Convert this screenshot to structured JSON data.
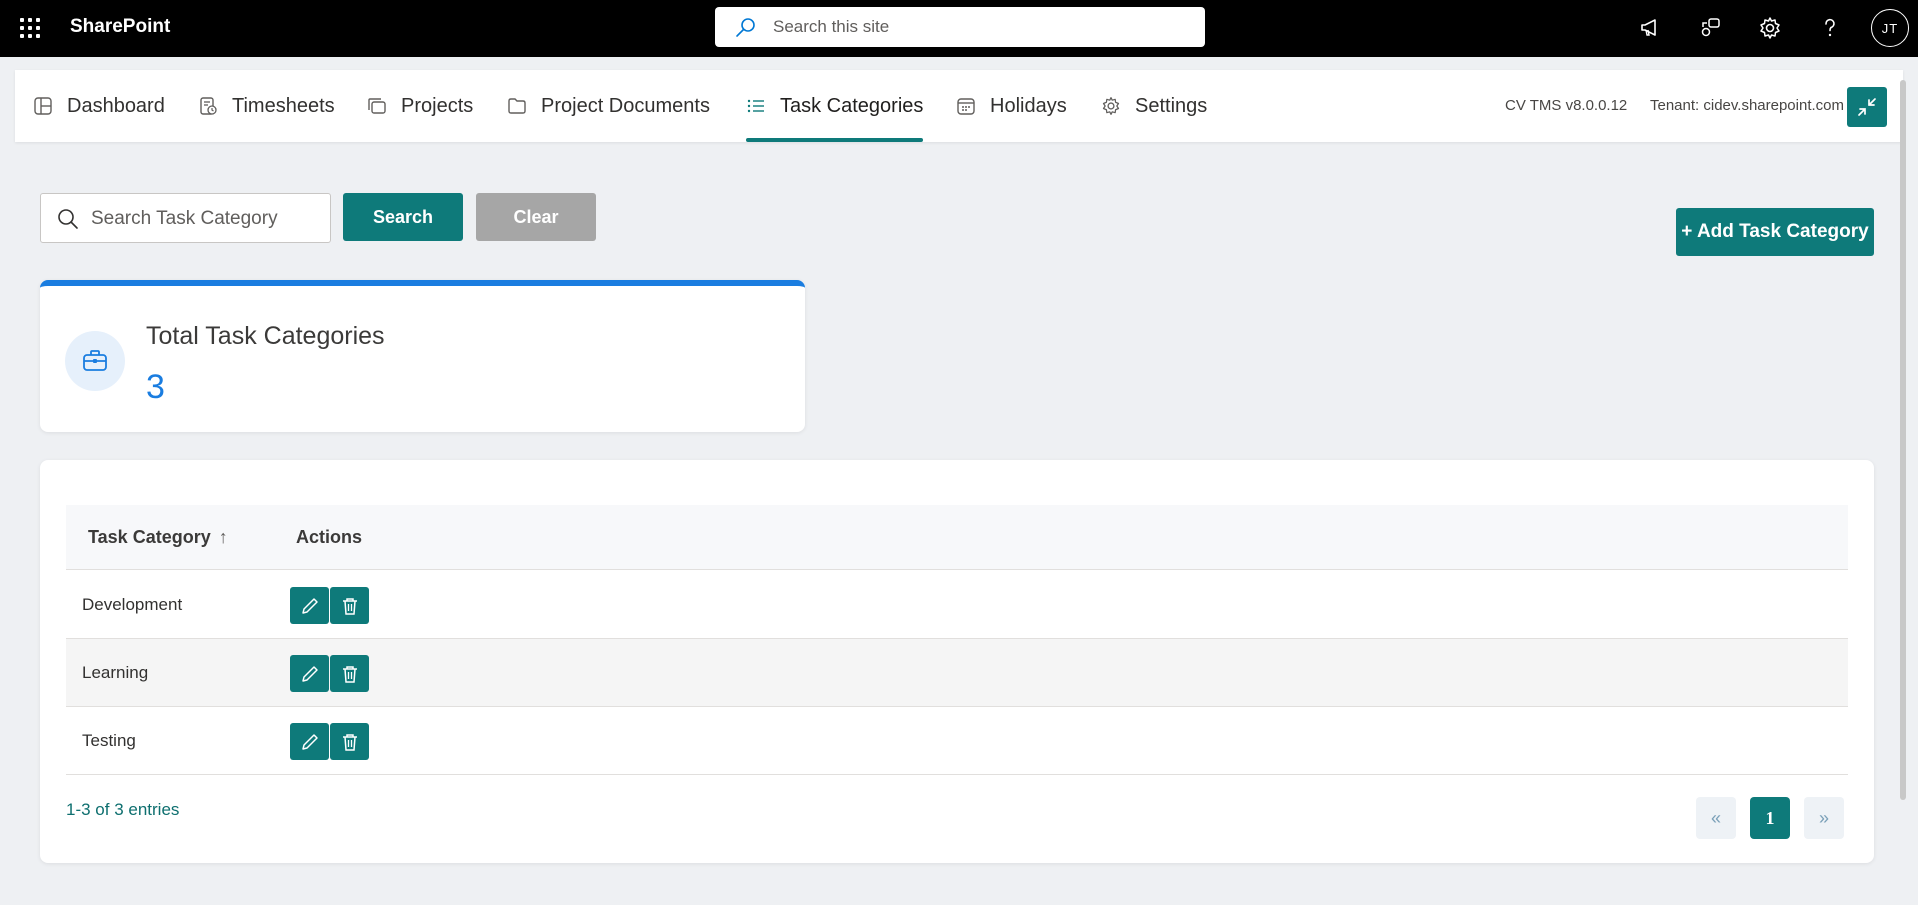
{
  "suite_bar": {
    "brand": "SharePoint",
    "search_placeholder": "Search this site",
    "avatar_initials": "JT"
  },
  "tabs": [
    {
      "label": "Dashboard",
      "icon": "dashboard-icon"
    },
    {
      "label": "Timesheets",
      "icon": "timesheet-icon"
    },
    {
      "label": "Projects",
      "icon": "projects-icon"
    },
    {
      "label": "Project Documents",
      "icon": "folder-icon"
    },
    {
      "label": "Task Categories",
      "icon": "list-icon",
      "active": true
    },
    {
      "label": "Holidays",
      "icon": "calendar-icon"
    },
    {
      "label": "Settings",
      "icon": "gear-icon"
    }
  ],
  "header_info": {
    "version": "CV TMS v8.0.0.12",
    "tenant": "Tenant: cidev.sharepoint.com"
  },
  "toolbar": {
    "search_placeholder": "Search Task Category",
    "search_label": "Search",
    "clear_label": "Clear",
    "add_label": "+ Add Task Category"
  },
  "stat": {
    "title": "Total Task Categories",
    "value": "3"
  },
  "table": {
    "columns": [
      "Task Category",
      "Actions"
    ],
    "sort_indicator": "↑",
    "rows": [
      {
        "name": "Development"
      },
      {
        "name": "Learning"
      },
      {
        "name": "Testing"
      }
    ]
  },
  "pagination": {
    "entries": "1-3 of 3 entries",
    "prev": "«",
    "current": "1",
    "next": "»"
  },
  "colors": {
    "accent": "#0e7a7a",
    "stat_blue": "#1a7de0",
    "suite_bar": "#000000"
  }
}
